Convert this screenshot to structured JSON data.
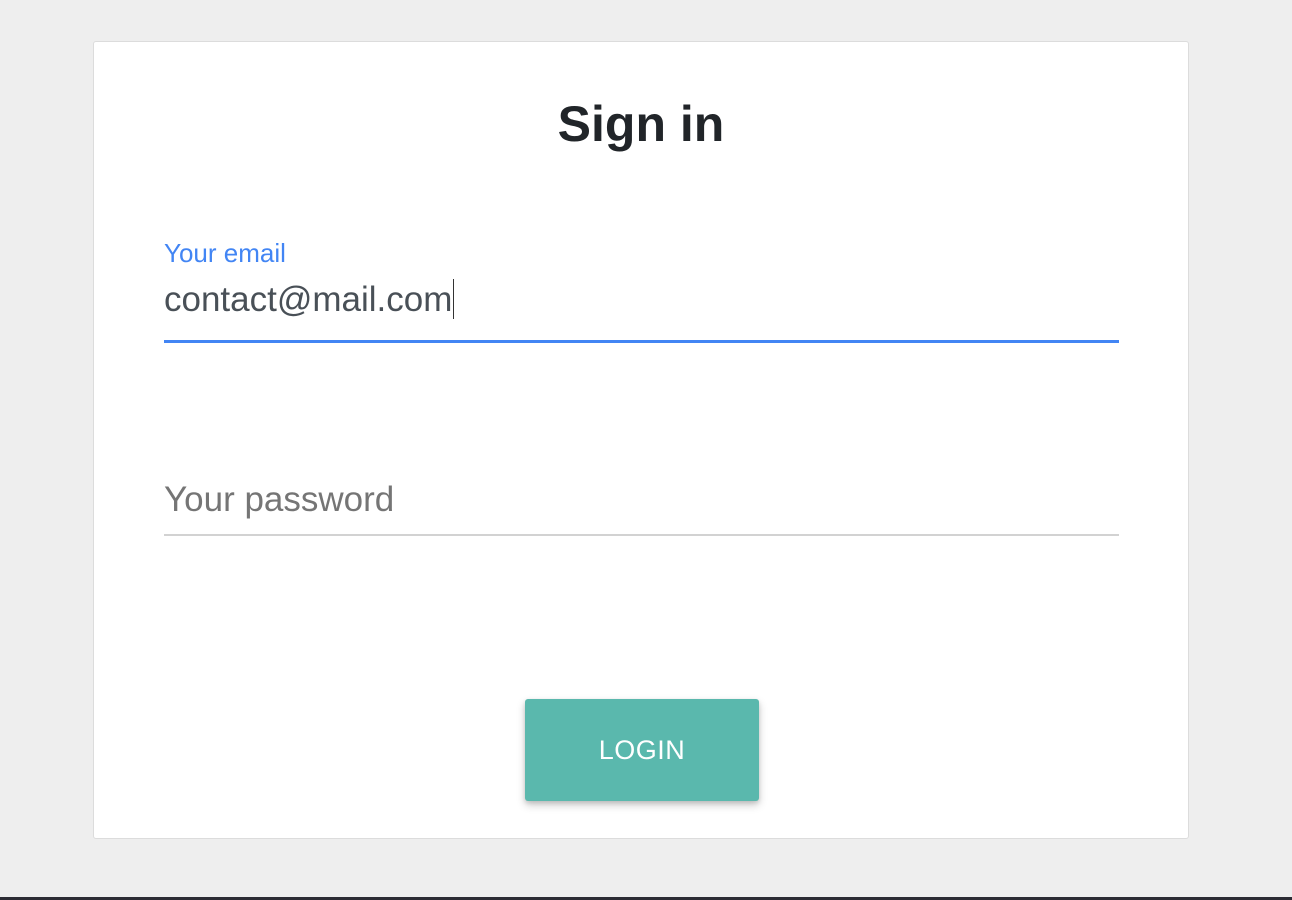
{
  "form": {
    "title": "Sign in",
    "email": {
      "label": "Your email",
      "value": "contact@mail.com"
    },
    "password": {
      "placeholder": "Your password",
      "value": ""
    },
    "login_label": "LOGIN"
  },
  "colors": {
    "background": "#eeeeee",
    "card": "#ffffff",
    "accent_blue": "#4285f4",
    "button_teal": "#5ab8ad",
    "title_text": "#212529",
    "placeholder_text": "#757575"
  }
}
